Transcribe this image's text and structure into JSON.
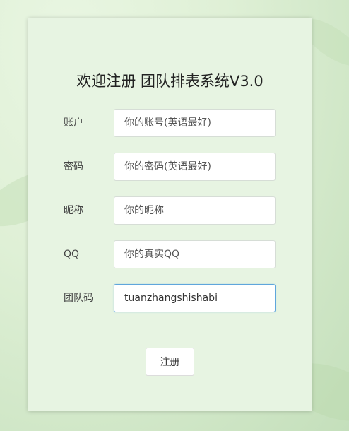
{
  "form": {
    "title": "欢迎注册 团队排表系统V3.0",
    "fields": [
      {
        "label": "账户",
        "placeholder": "你的账号(英语最好)",
        "value": ""
      },
      {
        "label": "密码",
        "placeholder": "你的密码(英语最好)",
        "value": ""
      },
      {
        "label": "昵称",
        "placeholder": "你的昵称",
        "value": ""
      },
      {
        "label": "QQ",
        "placeholder": "你的真实QQ",
        "value": ""
      },
      {
        "label": "团队码",
        "placeholder": "",
        "value": "tuanzhangshishabi"
      }
    ],
    "submit_label": "注册"
  },
  "colors": {
    "card_background": "#e7f4e2",
    "focus_border": "#5fa6dc",
    "page_background": "#dff0d6"
  }
}
